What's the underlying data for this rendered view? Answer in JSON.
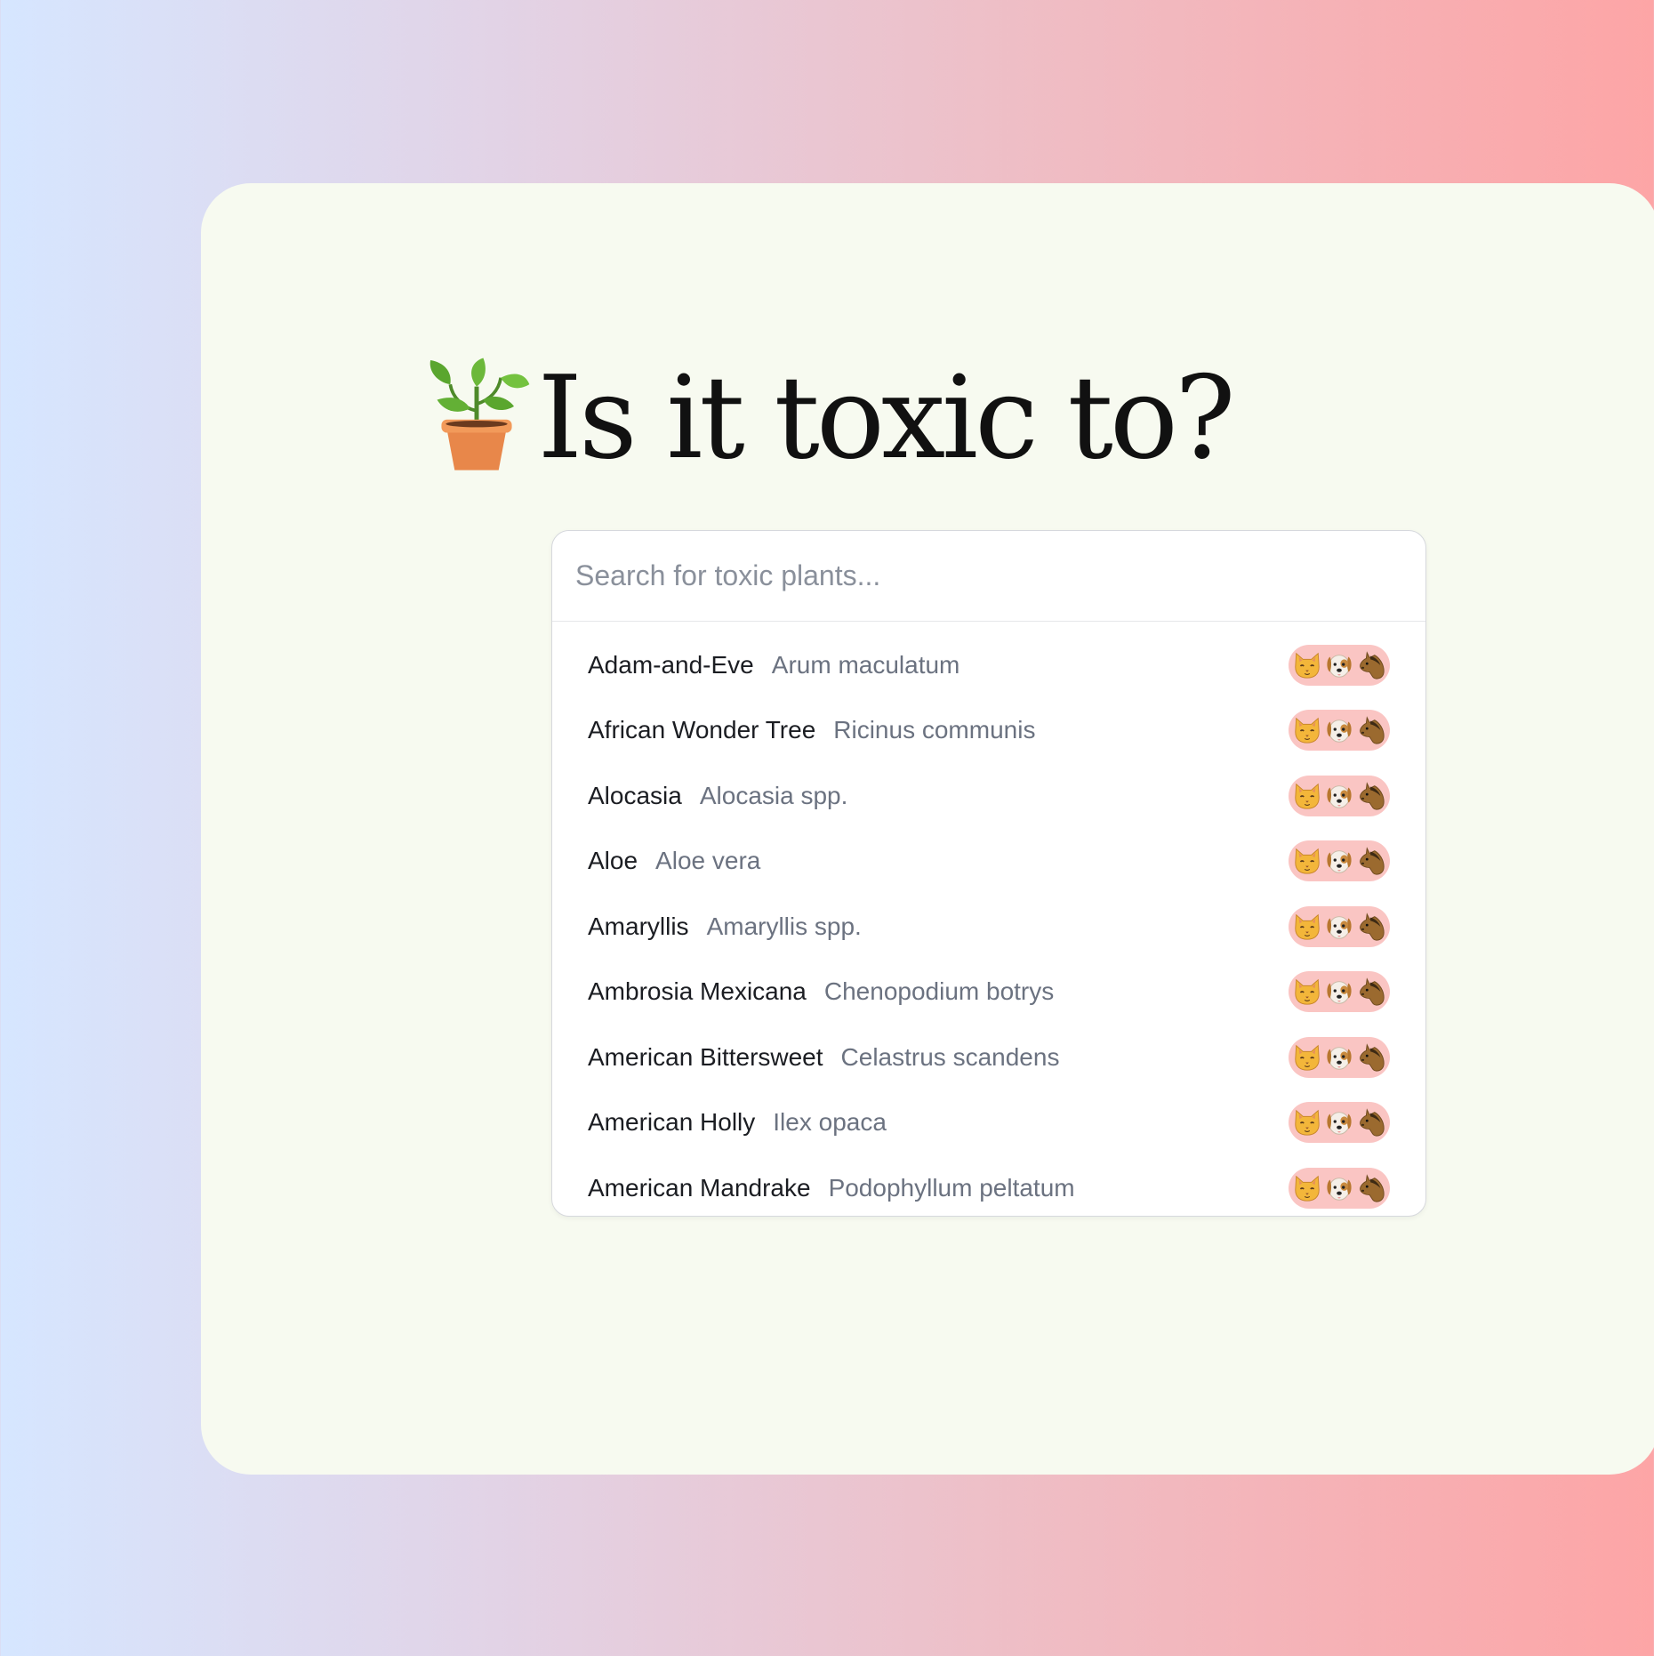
{
  "header": {
    "title": "Is it toxic to?",
    "icon": "potted-plant-icon"
  },
  "search": {
    "placeholder": "Search for toxic plants...",
    "value": ""
  },
  "badge": {
    "icons": [
      "cat-face-icon",
      "dog-face-icon",
      "horse-face-icon"
    ],
    "color": "#fac5c3"
  },
  "plants": [
    {
      "common": "Adam-and-Eve",
      "scientific": "Arum maculatum"
    },
    {
      "common": "African Wonder Tree",
      "scientific": "Ricinus communis"
    },
    {
      "common": "Alocasia",
      "scientific": "Alocasia spp."
    },
    {
      "common": "Aloe",
      "scientific": "Aloe vera"
    },
    {
      "common": "Amaryllis",
      "scientific": "Amaryllis spp."
    },
    {
      "common": "Ambrosia Mexicana",
      "scientific": "Chenopodium botrys"
    },
    {
      "common": "American Bittersweet",
      "scientific": "Celastrus scandens"
    },
    {
      "common": "American Holly",
      "scientific": "Ilex opaca"
    },
    {
      "common": "American Mandrake",
      "scientific": "Podophyllum peltatum"
    }
  ]
}
